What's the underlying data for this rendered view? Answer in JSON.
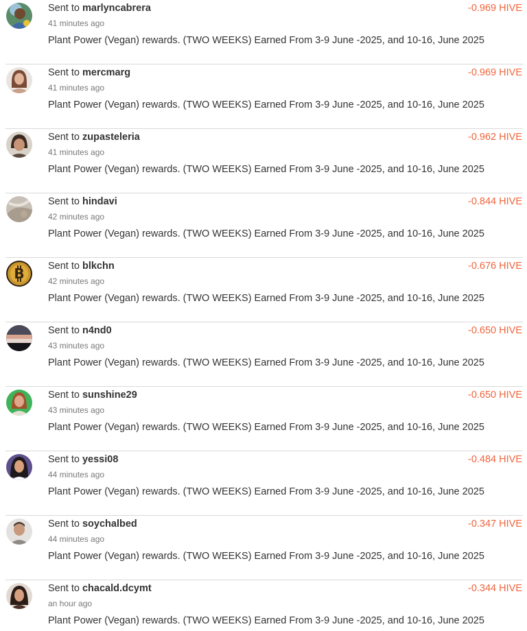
{
  "transfers": [
    {
      "prefix": "Sent to",
      "username": "marlyncabrera",
      "time": "41 minutes ago",
      "memo": "Plant Power (Vegan) rewards. (TWO WEEKS) Earned From 3-9 June -2025, and 10-16, June 2025",
      "amount": "-0.969 HIVE",
      "avatar_icon": "user-avatar"
    },
    {
      "prefix": "Sent to",
      "username": "mercmarg",
      "time": "41 minutes ago",
      "memo": "Plant Power (Vegan) rewards. (TWO WEEKS) Earned From 3-9 June -2025, and 10-16, June 2025",
      "amount": "-0.969 HIVE",
      "avatar_icon": "user-avatar"
    },
    {
      "prefix": "Sent to",
      "username": "zupasteleria",
      "time": "41 minutes ago",
      "memo": "Plant Power (Vegan) rewards. (TWO WEEKS) Earned From 3-9 June -2025, and 10-16, June 2025",
      "amount": "-0.962 HIVE",
      "avatar_icon": "user-avatar"
    },
    {
      "prefix": "Sent to",
      "username": "hindavi",
      "time": "42 minutes ago",
      "memo": "Plant Power (Vegan) rewards. (TWO WEEKS) Earned From 3-9 June -2025, and 10-16, June 2025",
      "amount": "-0.844 HIVE",
      "avatar_icon": "user-avatar"
    },
    {
      "prefix": "Sent to",
      "username": "blkchn",
      "time": "42 minutes ago",
      "memo": "Plant Power (Vegan) rewards. (TWO WEEKS) Earned From 3-9 June -2025, and 10-16, June 2025",
      "amount": "-0.676 HIVE",
      "avatar_icon": "bitcoin-avatar"
    },
    {
      "prefix": "Sent to",
      "username": "n4nd0",
      "time": "43 minutes ago",
      "memo": "Plant Power (Vegan) rewards. (TWO WEEKS) Earned From 3-9 June -2025, and 10-16, June 2025",
      "amount": "-0.650 HIVE",
      "avatar_icon": "landscape-avatar"
    },
    {
      "prefix": "Sent to",
      "username": "sunshine29",
      "time": "43 minutes ago",
      "memo": "Plant Power (Vegan) rewards. (TWO WEEKS) Earned From 3-9 June -2025, and 10-16, June 2025",
      "amount": "-0.650 HIVE",
      "avatar_icon": "user-avatar"
    },
    {
      "prefix": "Sent to",
      "username": "yessi08",
      "time": "44 minutes ago",
      "memo": "Plant Power (Vegan) rewards. (TWO WEEKS) Earned From 3-9 June -2025, and 10-16, June 2025",
      "amount": "-0.484 HIVE",
      "avatar_icon": "user-avatar"
    },
    {
      "prefix": "Sent to",
      "username": "soychalbed",
      "time": "44 minutes ago",
      "memo": "Plant Power (Vegan) rewards. (TWO WEEKS) Earned From 3-9 June -2025, and 10-16, June 2025",
      "amount": "-0.347 HIVE",
      "avatar_icon": "user-avatar"
    },
    {
      "prefix": "Sent to",
      "username": "chacald.dcymt",
      "time": "an hour ago",
      "memo": "Plant Power (Vegan) rewards. (TWO WEEKS) Earned From 3-9 June -2025, and 10-16, June 2025",
      "amount": "-0.344 HIVE",
      "avatar_icon": "user-avatar"
    }
  ],
  "colors": {
    "amount": "#f0643c",
    "divider": "#d9d9d9",
    "text": "#333333",
    "muted": "#777777"
  }
}
